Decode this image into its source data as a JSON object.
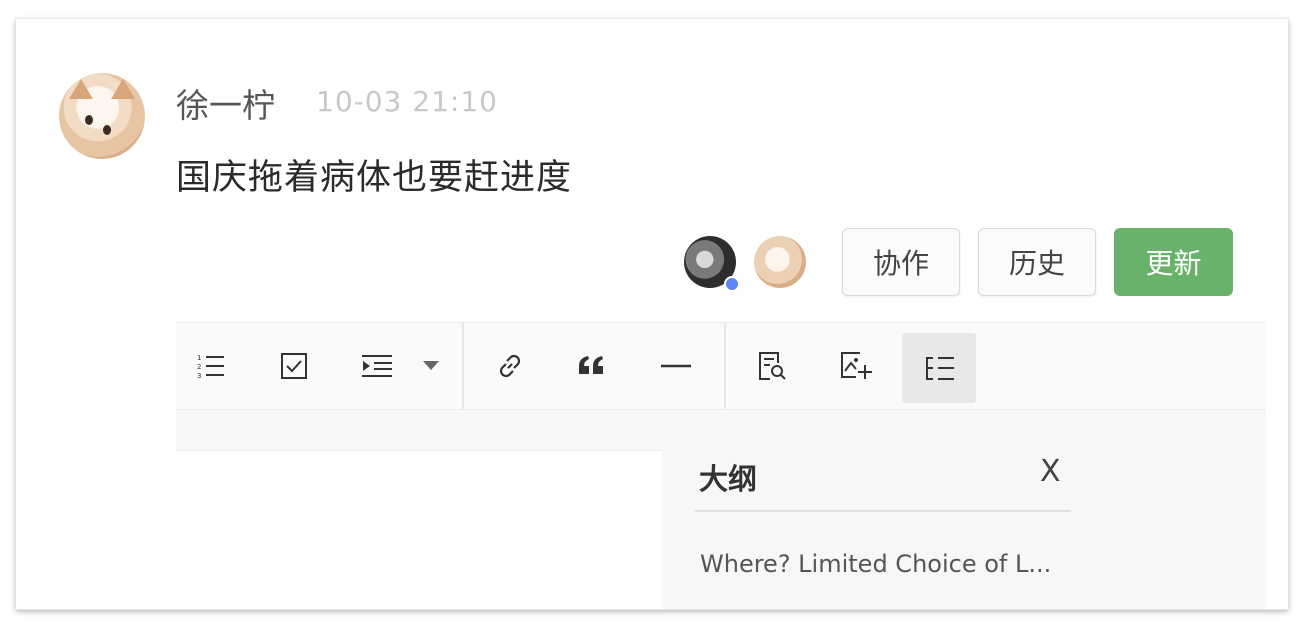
{
  "comment": {
    "author": "徐一柠",
    "time": "10-03 21:10",
    "message": "国庆拖着病体也要赶进度"
  },
  "actions": {
    "collab_label": "协作",
    "history_label": "历史",
    "update_label": "更新"
  },
  "colors": {
    "update_bg": "#69b26a",
    "online_dot": "#5b84f5"
  },
  "toolbar": {
    "icons": [
      "ordered-list-icon",
      "checkbox-icon",
      "indent-icon",
      "dropdown-caret-icon",
      "link-icon",
      "quote-icon",
      "horizontal-rule-icon",
      "doc-search-icon",
      "image-add-icon",
      "outline-toggle-icon"
    ]
  },
  "outline": {
    "title": "大纲",
    "close": "X",
    "items": [
      "Where? Limited Choice of L..."
    ]
  }
}
